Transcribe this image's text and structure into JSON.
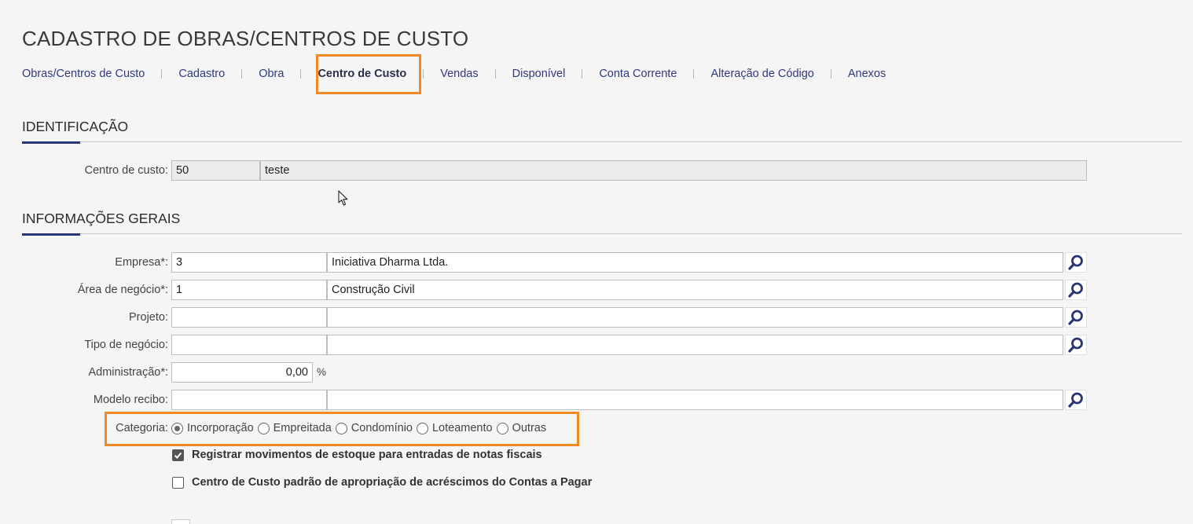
{
  "page": {
    "title": "CADASTRO DE OBRAS/CENTROS DE CUSTO"
  },
  "tabs": [
    {
      "label": "Obras/Centros de Custo"
    },
    {
      "label": "Cadastro"
    },
    {
      "label": "Obra"
    },
    {
      "label": "Centro de Custo",
      "active": true
    },
    {
      "label": "Vendas"
    },
    {
      "label": "Disponível"
    },
    {
      "label": "Conta Corrente"
    },
    {
      "label": "Alteração de Código"
    },
    {
      "label": "Anexos"
    }
  ],
  "identificacao": {
    "title": "IDENTIFICAÇÃO",
    "centro_custo": {
      "label": "Centro de custo:",
      "code": "50",
      "name": "teste"
    }
  },
  "informacoes_gerais": {
    "title": "INFORMAÇÕES GERAIS",
    "empresa": {
      "label": "Empresa*:",
      "code": "3",
      "name": "Iniciativa Dharma Ltda."
    },
    "area_negocio": {
      "label": "Área de negócio*:",
      "code": "1",
      "name": "Construção Civil"
    },
    "projeto": {
      "label": "Projeto:",
      "code": "",
      "name": ""
    },
    "tipo_negocio": {
      "label": "Tipo de negócio:",
      "code": "",
      "name": ""
    },
    "administracao": {
      "label": "Administração*:",
      "value": "0,00",
      "unit": "%"
    },
    "modelo_recibo": {
      "label": "Modelo recibo:",
      "code": "",
      "name": ""
    },
    "categoria": {
      "label": "Categoria:",
      "options": [
        "Incorporação",
        "Empreitada",
        "Condomínio",
        "Loteamento",
        "Outras"
      ],
      "selected": "Incorporação"
    },
    "registrar_movimentos": {
      "label": "Registrar movimentos de estoque para entradas de notas fiscais",
      "checked": true
    },
    "centro_custo_padrao": {
      "label": "Centro de Custo padrão de apropriação de acréscimos do Contas a Pagar",
      "checked": false
    }
  },
  "colors": {
    "accent": "#2a3573",
    "tab_link": "#2e3a7c",
    "highlight": "#f08a24",
    "background": "#f5f5f5"
  },
  "icons": {
    "lookup": "search-icon",
    "cursor": "mouse-pointer-icon"
  }
}
